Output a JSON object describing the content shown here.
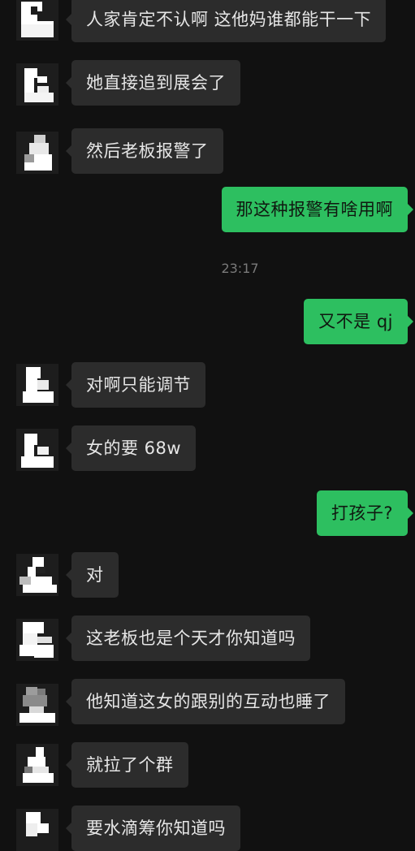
{
  "chat": {
    "messages": [
      {
        "side": "in",
        "text": "人家肯定不认啊 这他妈谁都能干一下"
      },
      {
        "side": "in",
        "text": "她直接追到展会了"
      },
      {
        "side": "in",
        "text": "然后老板报警了"
      },
      {
        "side": "out",
        "text": "那这种报警有啥用啊"
      },
      {
        "type": "time",
        "text": "23:17"
      },
      {
        "side": "out",
        "text": "又不是 qj"
      },
      {
        "side": "in",
        "text": "对啊只能调节"
      },
      {
        "side": "in",
        "text": "女的要 68w"
      },
      {
        "side": "out",
        "text": "打孩子?"
      },
      {
        "side": "in",
        "text": "对"
      },
      {
        "side": "in",
        "text": "这老板也是个天才你知道吗"
      },
      {
        "side": "in",
        "text": "他知道这女的跟别的互动也睡了"
      },
      {
        "side": "in",
        "text": "就拉了个群"
      },
      {
        "side": "in",
        "text": "要水滴筹你知道吗"
      }
    ]
  },
  "colors": {
    "background": "#111111",
    "incoming_bubble": "#2c2c2c",
    "outgoing_bubble": "#2dbf60",
    "timestamp": "#7a7a7a"
  },
  "icons": {
    "avatar": "pixelated-avatar-icon"
  }
}
